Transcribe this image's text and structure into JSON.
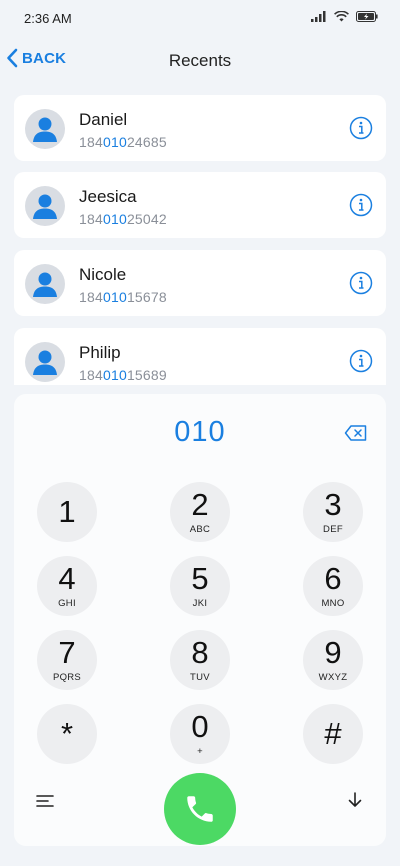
{
  "status_bar": {
    "time": "2:36 AM"
  },
  "nav": {
    "back_label": "BACK",
    "title": "Recents"
  },
  "contacts": [
    {
      "name": "Daniel",
      "number_prefix": "184",
      "number_match": "010",
      "number_suffix": "24685"
    },
    {
      "name": "Jeesica",
      "number_prefix": "184",
      "number_match": "010",
      "number_suffix": "25042"
    },
    {
      "name": "Nicole",
      "number_prefix": "184",
      "number_match": "010",
      "number_suffix": "15678"
    },
    {
      "name": "Philip",
      "number_prefix": "184",
      "number_match": "010",
      "number_suffix": "15689"
    }
  ],
  "dialer": {
    "entered": "010",
    "keys": [
      {
        "digit": "1",
        "letters": ""
      },
      {
        "digit": "2",
        "letters": "ABC"
      },
      {
        "digit": "3",
        "letters": "DEF"
      },
      {
        "digit": "4",
        "letters": "GHI"
      },
      {
        "digit": "5",
        "letters": "JKI"
      },
      {
        "digit": "6",
        "letters": "MNO"
      },
      {
        "digit": "7",
        "letters": "PQRS"
      },
      {
        "digit": "8",
        "letters": "TUV"
      },
      {
        "digit": "9",
        "letters": "WXYZ"
      },
      {
        "digit": "*",
        "letters": ""
      },
      {
        "digit": "0",
        "letters": "+"
      },
      {
        "digit": "#",
        "letters": ""
      }
    ]
  },
  "icons": {
    "back": "chevron-left-icon",
    "info": "info-icon",
    "delete": "backspace-icon",
    "menu": "menu-icon",
    "call": "phone-icon",
    "collapse": "arrow-down-icon"
  },
  "colors": {
    "accent": "#1a7fe0",
    "call": "#4cd964",
    "background": "#f1f4f8"
  }
}
